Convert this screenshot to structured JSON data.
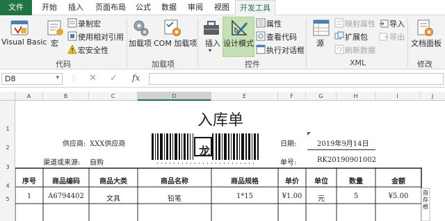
{
  "tabs": [
    "文件",
    "开始",
    "插入",
    "页面布局",
    "公式",
    "数据",
    "审阅",
    "视图",
    "开发工具"
  ],
  "ribbon": {
    "code": {
      "visual_basic": "Visual Basic",
      "macro": "宏",
      "record_macro": "录制宏",
      "relative_ref": "使用相对引用",
      "macro_security": "宏安全性",
      "group": "代码"
    },
    "addins": {
      "addins": "加载项",
      "com_addins": "COM 加载项",
      "group": "加载项"
    },
    "controls": {
      "insert": "插入",
      "design_mode": "设计模式",
      "properties": "属性",
      "view_code": "查看代码",
      "run_dialog": "执行对话框",
      "group": "控件"
    },
    "xml": {
      "source": "源",
      "map_properties": "映射属性",
      "expansion_packs": "扩展包",
      "refresh_data": "刷新数据",
      "import": "导入",
      "export": "导出",
      "group": "XML"
    },
    "modify": {
      "doc_panel": "文档面板",
      "group": "修改"
    }
  },
  "formula_bar": {
    "name_box": "D8",
    "fx": "fx",
    "value": ""
  },
  "columns": [
    "A",
    "B",
    "C",
    "D",
    "E",
    "F",
    "G",
    "H",
    "I",
    "J"
  ],
  "rows": [
    "1",
    "2",
    "3",
    "4",
    "5"
  ],
  "sheet": {
    "title": "入库单",
    "supplier_label": "供应商:",
    "supplier_value": "XXX供应商",
    "date_label": "日期:",
    "date_value": "2019年9月14日",
    "channel_label": "渠道或来源:",
    "channel_value": "自购",
    "order_label": "单号:",
    "order_value": "RK20190901002",
    "barcode_char": "龙",
    "table_headers": [
      "序号",
      "商品编码",
      "商品大类",
      "商品名称",
      "商品规格",
      "单价",
      "单位",
      "数量",
      "金额"
    ],
    "table_row": [
      "1",
      "A6794402",
      "文具",
      "铅笔",
      "1*15",
      "¥1.00",
      "元",
      "5",
      "¥5.00"
    ],
    "side_note": "自存根"
  },
  "colors": {
    "accent": "#217346",
    "design_mode_bg": "#c5e0b4"
  }
}
